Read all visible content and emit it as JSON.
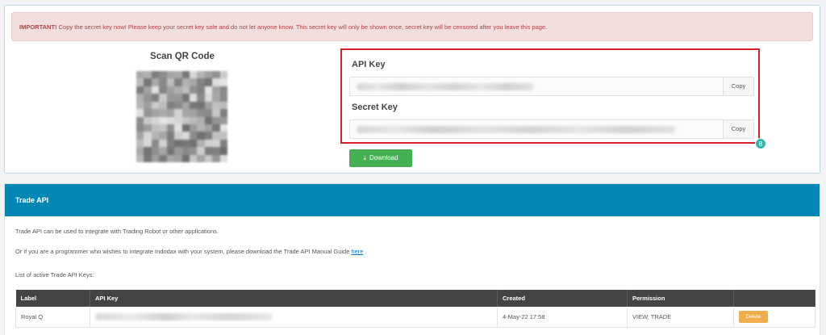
{
  "alert": {
    "prefix": "IMPORTANT!",
    "text": " Copy the secret key now! Please keep your secret key safe and do not let anyone know. This secret key will only be shown once, secret key will be censored after you leave this page."
  },
  "qr": {
    "title": "Scan QR Code"
  },
  "keys": {
    "api_key_label": "API Key",
    "secret_key_label": "Secret Key",
    "copy_label": "Copy",
    "badge": "8",
    "download_label": "Download"
  },
  "trade_api": {
    "title": "Trade API",
    "intro": "Trade API can be used to integrate with Trading Robot or other applications.",
    "programmer_text": "Or if you are a programmer who wishes to integrate Indodax with your system, please download the Trade API Manual Guide ",
    "link_text": "here",
    "link_suffix": " .",
    "list_label": "List of active Trade API Keys:",
    "columns": [
      "Label",
      "API Key",
      "Created",
      "Permission",
      ""
    ],
    "rows": [
      {
        "label": "Royal Q",
        "created": "4-May-22 17:58",
        "permission": "VIEW, TRADE",
        "action": "Delete"
      }
    ]
  },
  "colors": {
    "header_blue": "#0287b4",
    "alert_red": "#a94442",
    "highlight_red": "#d6202a",
    "download_green": "#45b053",
    "delete_orange": "#f0ad4e",
    "badge_teal": "#2fb7a9"
  }
}
